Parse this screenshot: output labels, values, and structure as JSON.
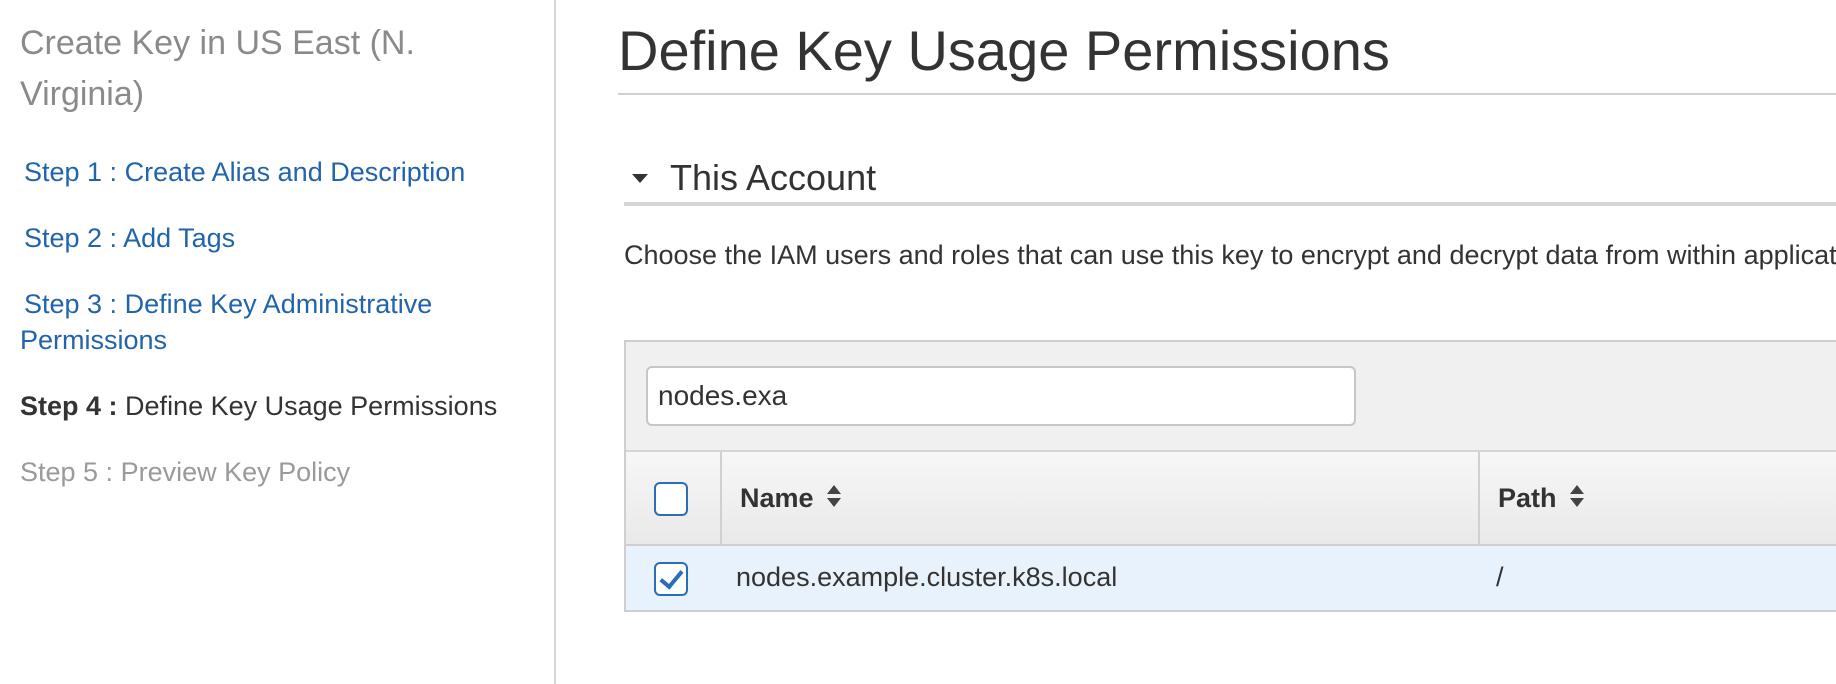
{
  "sidebar": {
    "title": "Create Key in US East (N. Virginia)",
    "steps": [
      {
        "num": "Step 1 :",
        "label": "Create Alias and Description"
      },
      {
        "num": "Step 2 :",
        "label": "Add Tags"
      },
      {
        "num": "Step 3 :",
        "label_line1": "Define Key Administrative",
        "label_line2": "Permissions"
      },
      {
        "num": "Step 4 :",
        "label": "Define Key Usage Permissions"
      },
      {
        "num": "Step 5 :",
        "label": "Preview Key Policy"
      }
    ]
  },
  "main": {
    "title": "Define Key Usage Permissions",
    "section": {
      "title": "This Account",
      "description": "Choose the IAM users and roles that can use this key to encrypt and decrypt data from within applications and when using AWS services integrated with KMS."
    },
    "table": {
      "filter_value": "nodes.exa",
      "columns": [
        "Name",
        "Path"
      ],
      "rows": [
        {
          "checked": true,
          "name": "nodes.example.cluster.k8s.local",
          "path": "/"
        }
      ]
    }
  },
  "colors": {
    "link": "#1f64ad",
    "muted": "#8a8a8a",
    "selected_row": "#e8f2fc",
    "checkbox_border": "#2c6db8"
  },
  "icons": {
    "section_toggle": "caret-down-icon",
    "sort": "sort-icon",
    "check": "checkmark-icon"
  }
}
